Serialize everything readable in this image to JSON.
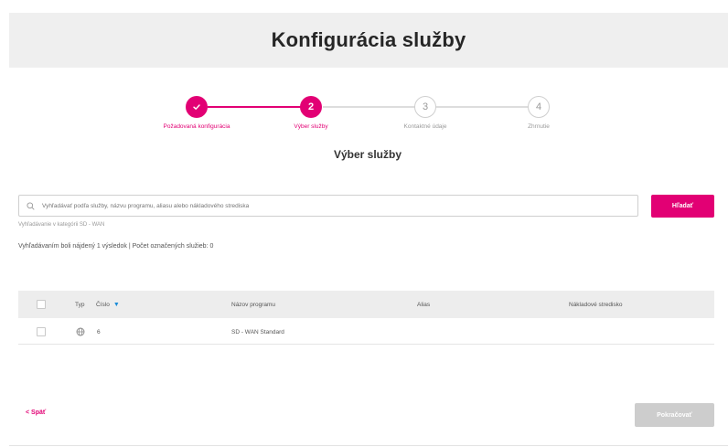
{
  "header": {
    "title": "Konfigurácia služby"
  },
  "stepper": {
    "steps": [
      {
        "number": "✓",
        "label": "Požadovaná konfigurácia",
        "state": "done"
      },
      {
        "number": "2",
        "label": "Výber služby",
        "state": "active"
      },
      {
        "number": "3",
        "label": "Kontaktné údaje",
        "state": "pending"
      },
      {
        "number": "4",
        "label": "Zhrnutie",
        "state": "pending"
      }
    ],
    "colors": {
      "accent": "#e20074",
      "pending_line": "#dddddd"
    }
  },
  "section": {
    "title": "Výber služby"
  },
  "search": {
    "placeholder": "Vyhľadávať podľa služby, názvu programu, aliasu alebo nákladového strediska",
    "button_label": "Hľadať",
    "hint": "Vyhľadávanie v kategórii SD - WAN"
  },
  "results": {
    "info": "Vyhľadávaním boli nájdený 1 výsledok | Počet označených služieb: 0"
  },
  "table": {
    "columns": {
      "type": "Typ",
      "number": "Číslo",
      "program": "Názov programu",
      "alias": "Alias",
      "cost_center": "Nákladové stredisko"
    },
    "rows": [
      {
        "type_icon": "globe-icon",
        "number": "6",
        "program": "SD - WAN Standard",
        "alias": "",
        "cost_center": ""
      }
    ]
  },
  "footer": {
    "back_label": "< Späť",
    "continue_label": "Pokračovať"
  }
}
